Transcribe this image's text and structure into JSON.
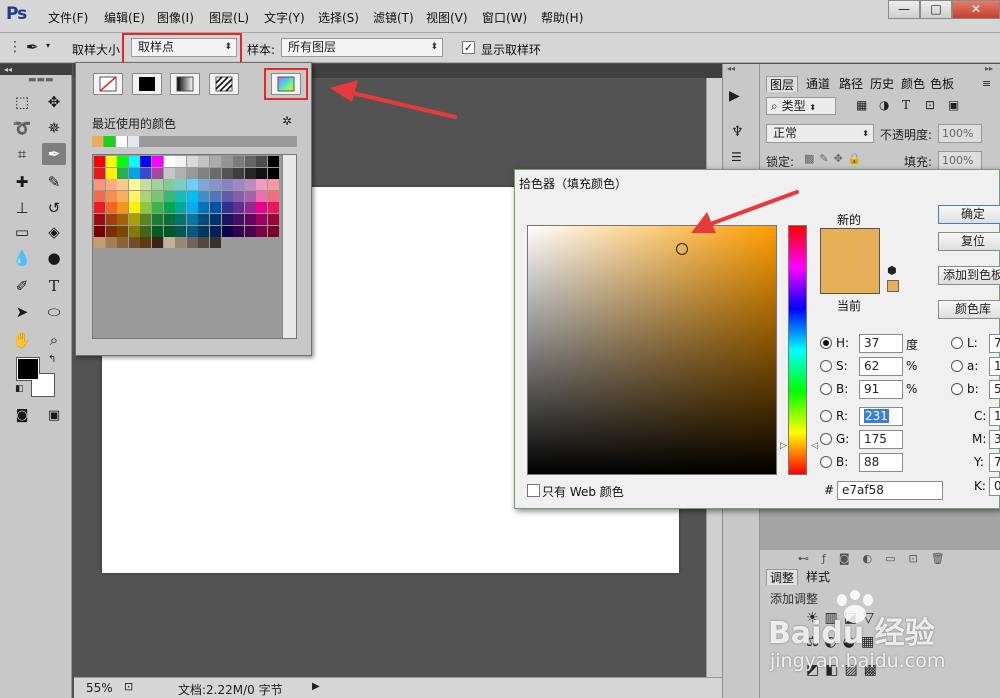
{
  "menu": {
    "logo": "Ps",
    "items": [
      "文件(F)",
      "编辑(E)",
      "图像(I)",
      "图层(L)",
      "文字(Y)",
      "选择(S)",
      "滤镜(T)",
      "视图(V)",
      "窗口(W)",
      "帮助(H)"
    ],
    "window_buttons": [
      "—",
      "□",
      "✕"
    ]
  },
  "options": {
    "sample_size_label": "取样大小",
    "sample_size_value": "取样点",
    "sample_label": "样本:",
    "sample_value": "所有图层",
    "show_ring_label": "显示取样环"
  },
  "swatch_panel": {
    "recent_label": "最近使用的颜色",
    "gear_icon": "gear-icon",
    "recent_colors": [
      "#e7af58",
      "#1ad21a",
      "#ffffff",
      "#e3e8f0"
    ]
  },
  "right_panel": {
    "tabs": [
      "图层",
      "通道",
      "路径",
      "历史",
      "颜色",
      "色板"
    ],
    "filter_label": "类型",
    "blend_mode": "正常",
    "opacity_label": "不透明度:",
    "opacity_value": "100%",
    "lock_label": "锁定:",
    "fill_label": "填充:",
    "fill_value": "100%",
    "adjust_tabs": [
      "调整",
      "样式"
    ],
    "adjust_label": "添加调整"
  },
  "status": {
    "zoom": "55%",
    "doc_info": "文档:2.22M/0 字节"
  },
  "picker": {
    "title": "拾色器（填充颜色）",
    "new_label": "新的",
    "current_label": "当前",
    "new_color": "#e7af58",
    "current_color": "#e7af58",
    "buttons": [
      "确定",
      "复位",
      "添加到色板",
      "颜色库"
    ],
    "hsb": [
      {
        "label": "H:",
        "value": "37",
        "unit": "度"
      },
      {
        "label": "S:",
        "value": "62",
        "unit": "%"
      },
      {
        "label": "B:",
        "value": "91",
        "unit": "%"
      }
    ],
    "rgb": [
      {
        "label": "R:",
        "value": "231"
      },
      {
        "label": "G:",
        "value": "175"
      },
      {
        "label": "B:",
        "value": "88"
      }
    ],
    "lab": [
      {
        "label": "L:",
        "value": "7"
      },
      {
        "label": "a:",
        "value": "1"
      },
      {
        "label": "b:",
        "value": "5"
      }
    ],
    "cmyk": [
      {
        "label": "C:",
        "value": "1"
      },
      {
        "label": "M:",
        "value": "3"
      },
      {
        "label": "Y:",
        "value": "7"
      },
      {
        "label": "K:",
        "value": "0"
      }
    ],
    "web_only_label": "只有 Web 颜色",
    "hex_label": "#",
    "hex_value": "e7af58"
  },
  "watermark": {
    "brand": "Baidu 经验",
    "url": "jingyan.baidu.com"
  }
}
